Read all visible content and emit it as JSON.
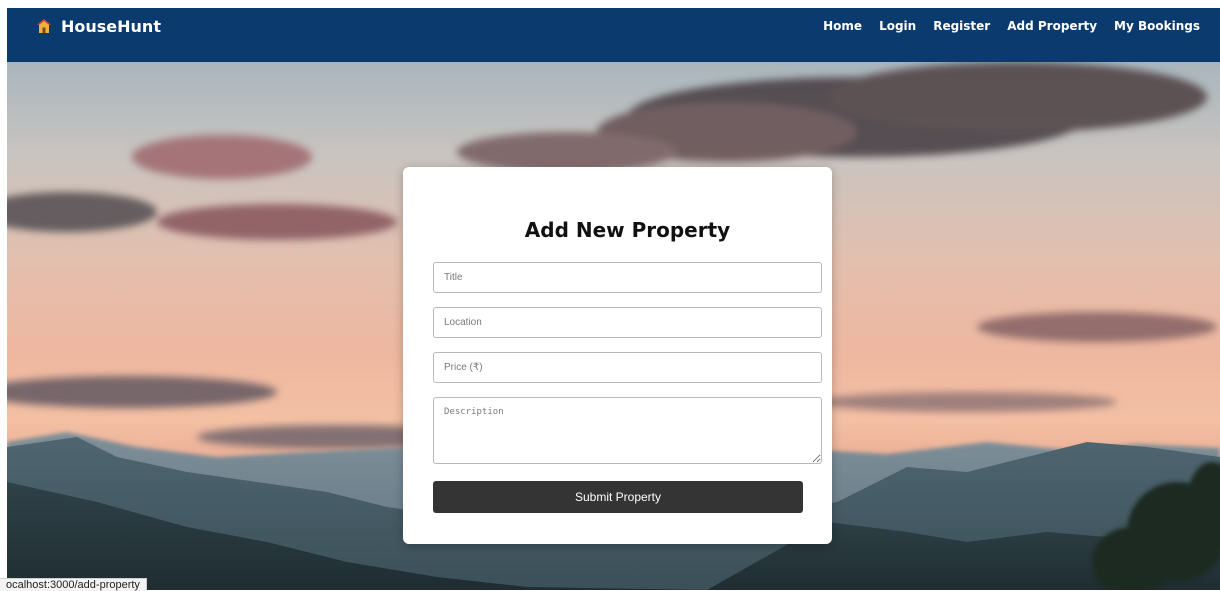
{
  "brand": {
    "name": "HouseHunt",
    "icon": "house-icon"
  },
  "nav": {
    "items": [
      {
        "label": "Home"
      },
      {
        "label": "Login"
      },
      {
        "label": "Register"
      },
      {
        "label": "Add Property"
      },
      {
        "label": "My Bookings"
      }
    ]
  },
  "form": {
    "title": "Add New Property",
    "title_placeholder": "Title",
    "location_placeholder": "Location",
    "price_placeholder": "Price (₹)",
    "description_placeholder": "Description",
    "submit_label": "Submit Property"
  },
  "status_bar": {
    "url": "ocalhost:3000/add-property"
  },
  "colors": {
    "navbar": "#0b3a6e",
    "button": "#343434",
    "card": "#ffffff"
  }
}
